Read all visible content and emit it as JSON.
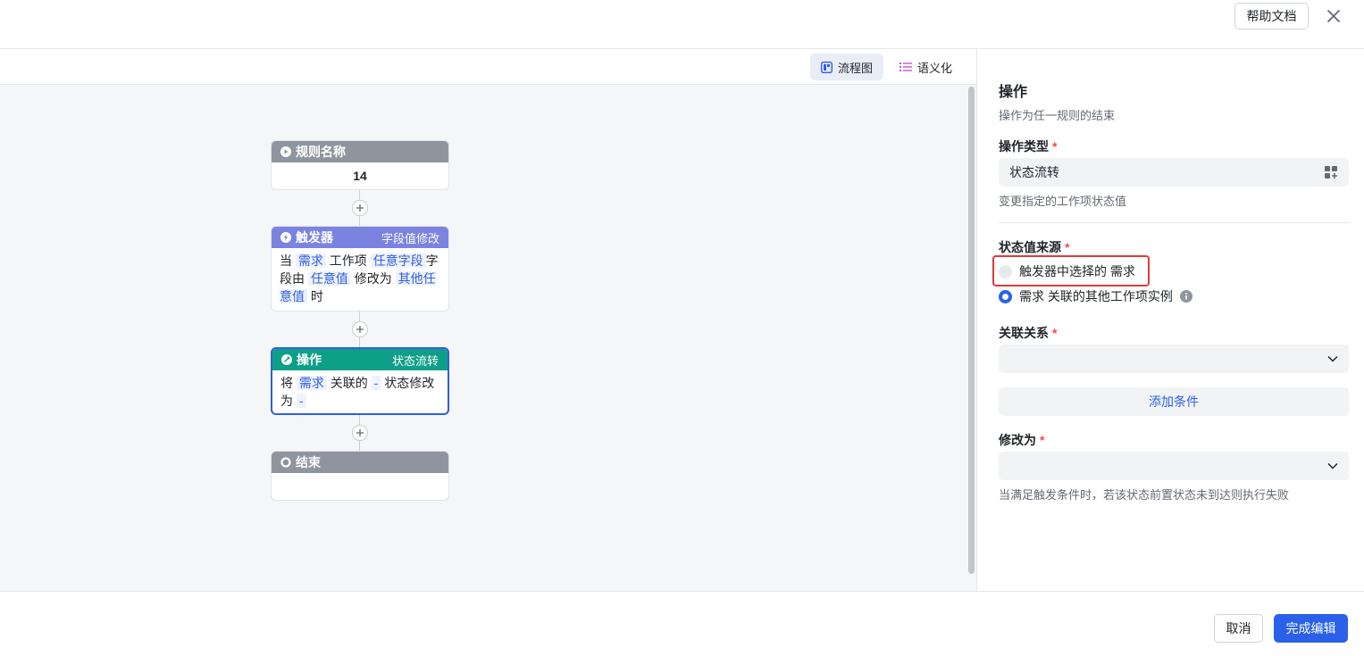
{
  "header": {
    "help_label": "帮助文档",
    "close_icon": "close-icon"
  },
  "toolbar": {
    "flow_tab": "流程图",
    "semantic_tab": "语义化"
  },
  "flow": {
    "rule_node": {
      "title": "规则名称",
      "value": "14"
    },
    "trigger_node": {
      "title": "触发器",
      "tag": "字段值修改",
      "text_1": "当",
      "hl_1": "需求",
      "text_2": "工作项",
      "hl_2": "任意字段",
      "text_3": "字段由",
      "hl_3": "任意值",
      "text_4": "修改为",
      "hl_4": "其他任意值",
      "text_5": "时"
    },
    "action_node": {
      "title": "操作",
      "tag": "状态流转",
      "text_1": "将",
      "hl_1": "需求",
      "text_2": "关联的",
      "hl_2": "-",
      "text_3": "状态修改为",
      "hl_3": "-"
    },
    "end_node": {
      "title": "结束"
    }
  },
  "panel": {
    "title": "操作",
    "subtitle": "操作为任一规则的结束",
    "action_type": {
      "label": "操作类型",
      "required": "*",
      "value": "状态流转",
      "help": "变更指定的工作项状态值"
    },
    "state_source": {
      "label": "状态值来源",
      "required": "*",
      "option_1": "触发器中选择的 需求",
      "option_2": "需求 关联的其他工作项实例",
      "selected": 2
    },
    "relation": {
      "label": "关联关系",
      "required": "*",
      "value": ""
    },
    "add_condition": "添加条件",
    "modify_to": {
      "label": "修改为",
      "required": "*",
      "value": "",
      "help": "当满足触发条件时，若该状态前置状态未到达则执行失败"
    }
  },
  "footer": {
    "cancel_label": "取消",
    "done_label": "完成编辑"
  },
  "colors": {
    "primary": "#2a61e8",
    "rule_header": "#8f959e",
    "trigger_header": "#7b83e0",
    "action_header": "#0e9f88",
    "end_header": "#8f959e",
    "selected_border": "#2f5ee4",
    "highlight_box": "#e03a3a"
  }
}
